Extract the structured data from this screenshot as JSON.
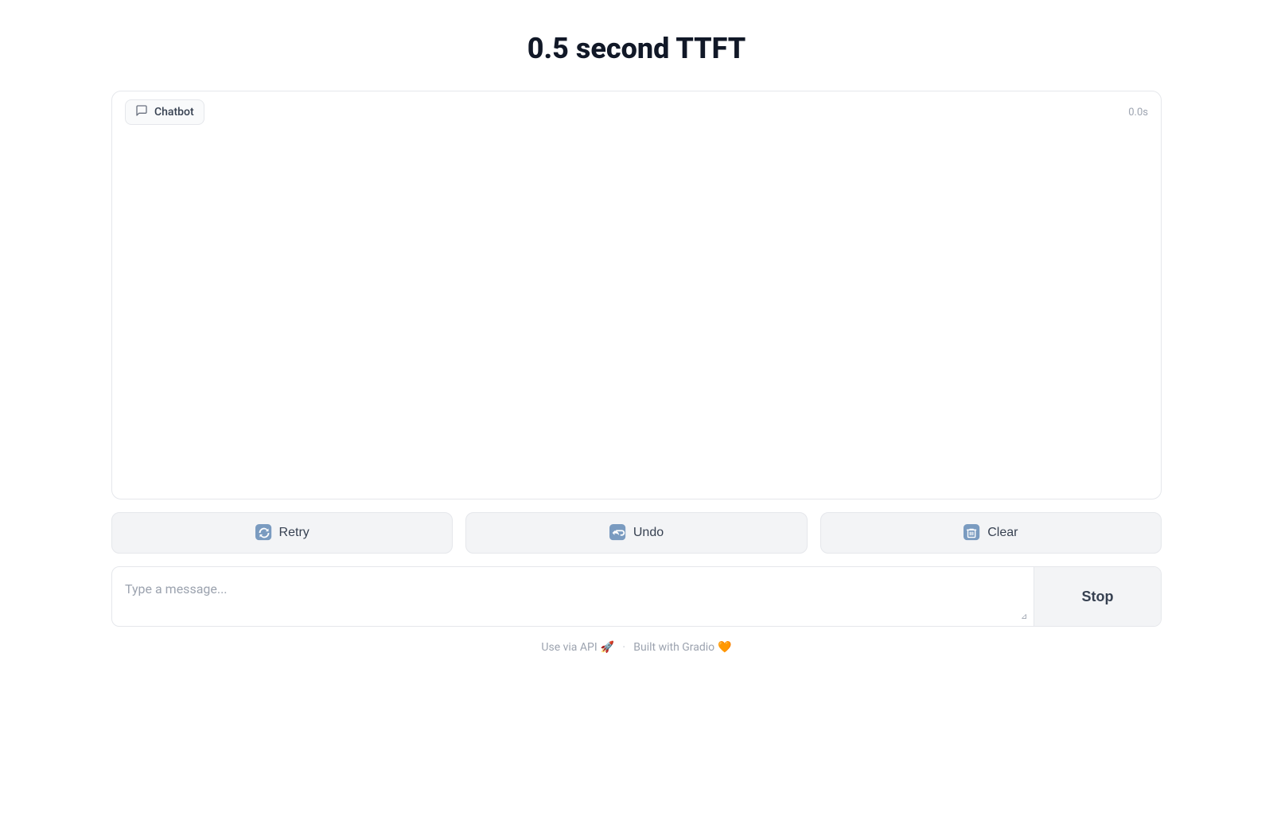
{
  "page": {
    "title": "0.5 second TTFT"
  },
  "chatbot": {
    "label": "Chatbot",
    "timer": "0.0s"
  },
  "buttons": {
    "retry_label": "Retry",
    "undo_label": "Undo",
    "clear_label": "Clear",
    "stop_label": "Stop"
  },
  "input": {
    "placeholder": "Type a message..."
  },
  "footer": {
    "api_label": "Use via API",
    "api_icon": "🚀",
    "separator": "·",
    "built_label": "Built with Gradio",
    "built_icon": "🧡"
  }
}
